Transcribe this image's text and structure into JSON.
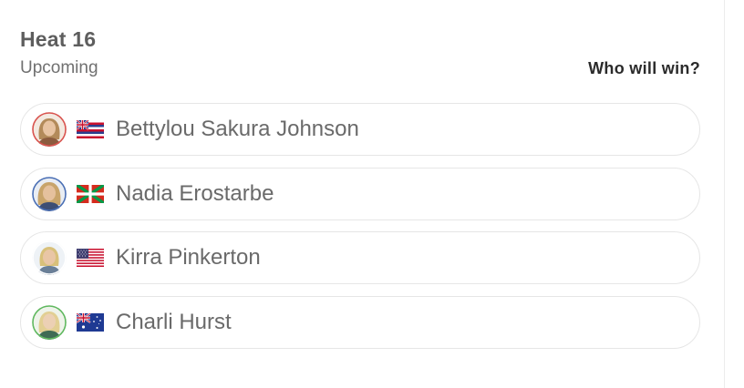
{
  "heat": {
    "title": "Heat 16",
    "status": "Upcoming",
    "prompt": "Who will win?"
  },
  "athletes": [
    {
      "name": "Bettylou Sakura Johnson",
      "flag_icon": "hawaii-flag-icon",
      "ring_color": "#d9534f",
      "hair_color": "#b38a5a",
      "skin_color": "#e8c3a2",
      "bg_color": "#f3e9e0",
      "shirt_color": "#8c5b3e"
    },
    {
      "name": "Nadia Erostarbe",
      "flag_icon": "basque-flag-icon",
      "ring_color": "#4a6fb5",
      "hair_color": "#c8a46a",
      "skin_color": "#e5c19d",
      "bg_color": "#e9edf3",
      "shirt_color": "#3d4e74"
    },
    {
      "name": "Kirra Pinkerton",
      "flag_icon": "usa-flag-icon",
      "ring_color": "#ffffff",
      "hair_color": "#d8c07a",
      "skin_color": "#e9c6a5",
      "bg_color": "#eef2f6",
      "shirt_color": "#6a7f97"
    },
    {
      "name": "Charli Hurst",
      "flag_icon": "australia-flag-icon",
      "ring_color": "#5fb85f",
      "hair_color": "#e2cf93",
      "skin_color": "#ecd0b4",
      "bg_color": "#eef3ea",
      "shirt_color": "#3f6b54"
    }
  ]
}
